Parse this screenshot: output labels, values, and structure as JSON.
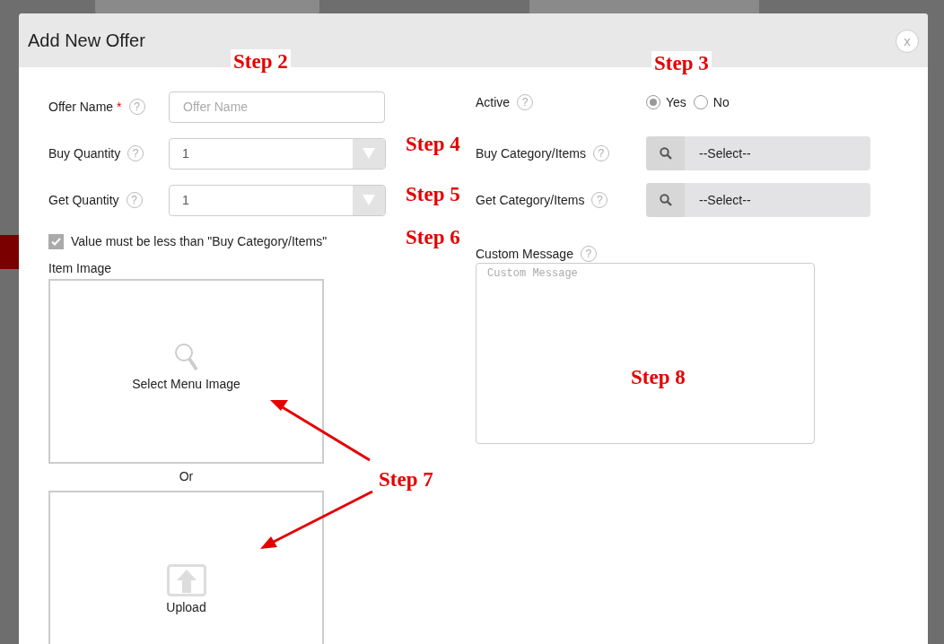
{
  "dialog": {
    "title": "Add New Offer",
    "close": "x"
  },
  "offer_name": {
    "label": "Offer Name",
    "required_mark": "*",
    "placeholder": "Offer Name"
  },
  "active": {
    "label": "Active",
    "options": [
      {
        "label": "Yes",
        "selected": true
      },
      {
        "label": "No",
        "selected": false
      }
    ]
  },
  "buy_quantity": {
    "label": "Buy Quantity",
    "value": "1"
  },
  "buy_category": {
    "label": "Buy Category/Items",
    "value": "--Select--"
  },
  "get_quantity": {
    "label": "Get Quantity",
    "value": "1"
  },
  "get_category": {
    "label": "Get Category/Items",
    "value": "--Select--"
  },
  "limit_check": {
    "label": "Value must be less than \"Buy Category/Items\"",
    "checked": true
  },
  "item_image": {
    "label": "Item Image",
    "select_label": "Select Menu Image",
    "or": "Or",
    "upload_label": "Upload"
  },
  "custom_message": {
    "label": "Custom Message",
    "placeholder": "Custom Message"
  },
  "help": "?",
  "annotations": [
    {
      "text": "Step 2",
      "kind": "top"
    },
    {
      "text": "Step 3",
      "kind": "top"
    },
    {
      "text": "Step 4",
      "kind": "plain"
    },
    {
      "text": "Step 5",
      "kind": "plain"
    },
    {
      "text": "Step 6",
      "kind": "plain"
    },
    {
      "text": "Step 7",
      "kind": "plain"
    },
    {
      "text": "Step 8",
      "kind": "plain"
    }
  ]
}
